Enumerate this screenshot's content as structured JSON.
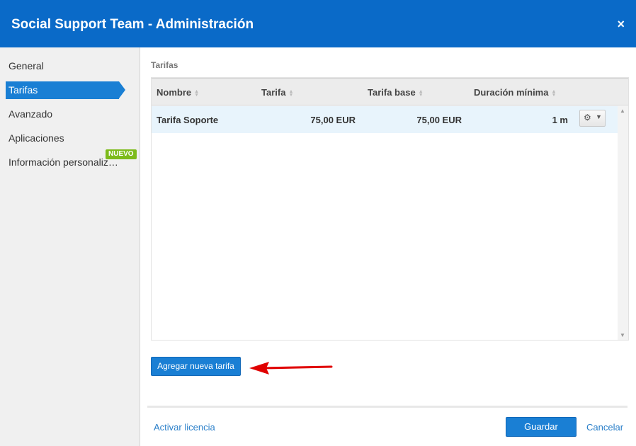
{
  "window": {
    "title": "Social Support Team - Administración",
    "close_glyph": "×"
  },
  "sidebar": {
    "items": [
      {
        "label": "General"
      },
      {
        "label": "Tarifas",
        "active": true
      },
      {
        "label": "Avanzado"
      },
      {
        "label": "Aplicaciones"
      },
      {
        "label": "Información personaliz…",
        "badge": "NUEVO"
      }
    ]
  },
  "main": {
    "section_title": "Tarifas",
    "table": {
      "columns": [
        "Nombre",
        "Tarifa",
        "Tarifa base",
        "Duración mínima"
      ],
      "rows": [
        {
          "nombre": "Tarifa Soporte",
          "tarifa": "75,00 EUR",
          "tarifa_base": "75,00 EUR",
          "duracion": "1 m",
          "action_icon": "gear-icon"
        }
      ]
    },
    "add_button": "Agregar nueva tarifa"
  },
  "footer": {
    "license_link": "Activar licencia",
    "save_button": "Guardar",
    "cancel_link": "Cancelar"
  },
  "colors": {
    "header": "#0a6ac8",
    "accent": "#1a7fd4",
    "badge": "#7dbb1b",
    "selected_row": "#e8f4fc",
    "annotation_arrow": "#e00000"
  }
}
